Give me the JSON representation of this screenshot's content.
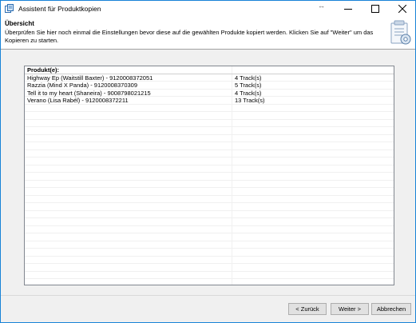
{
  "window": {
    "title": "Assistent für Produktkopien",
    "resize_glyph": "↔"
  },
  "header": {
    "title": "Übersicht",
    "description": "Überprüfen Sie hier noch einmal die Einstellungen bevor diese auf die gewählten Produkte kopiert werden. Klicken Sie auf \"Weiter\" um das Kopieren zu starten."
  },
  "table": {
    "header": "Produkt(e):",
    "rows": [
      {
        "product": "Highway Ep (Waitstill Baxter) - 9120008372051",
        "tracks": "4 Track(s)"
      },
      {
        "product": "Razzia (Mind X Panda) - 9120008370309",
        "tracks": "5 Track(s)"
      },
      {
        "product": "Tell it to my heart (Shaneira) - 9008798021215",
        "tracks": "4 Track(s)"
      },
      {
        "product": "Verano (Lisa Rabél) - 9120008372211",
        "tracks": "13 Track(s)"
      }
    ]
  },
  "buttons": {
    "back": "< Zurück",
    "next": "Weiter >",
    "cancel": "Abbrechen"
  },
  "colors": {
    "accent": "#1883d7",
    "window_bg": "#f0f0f0"
  }
}
